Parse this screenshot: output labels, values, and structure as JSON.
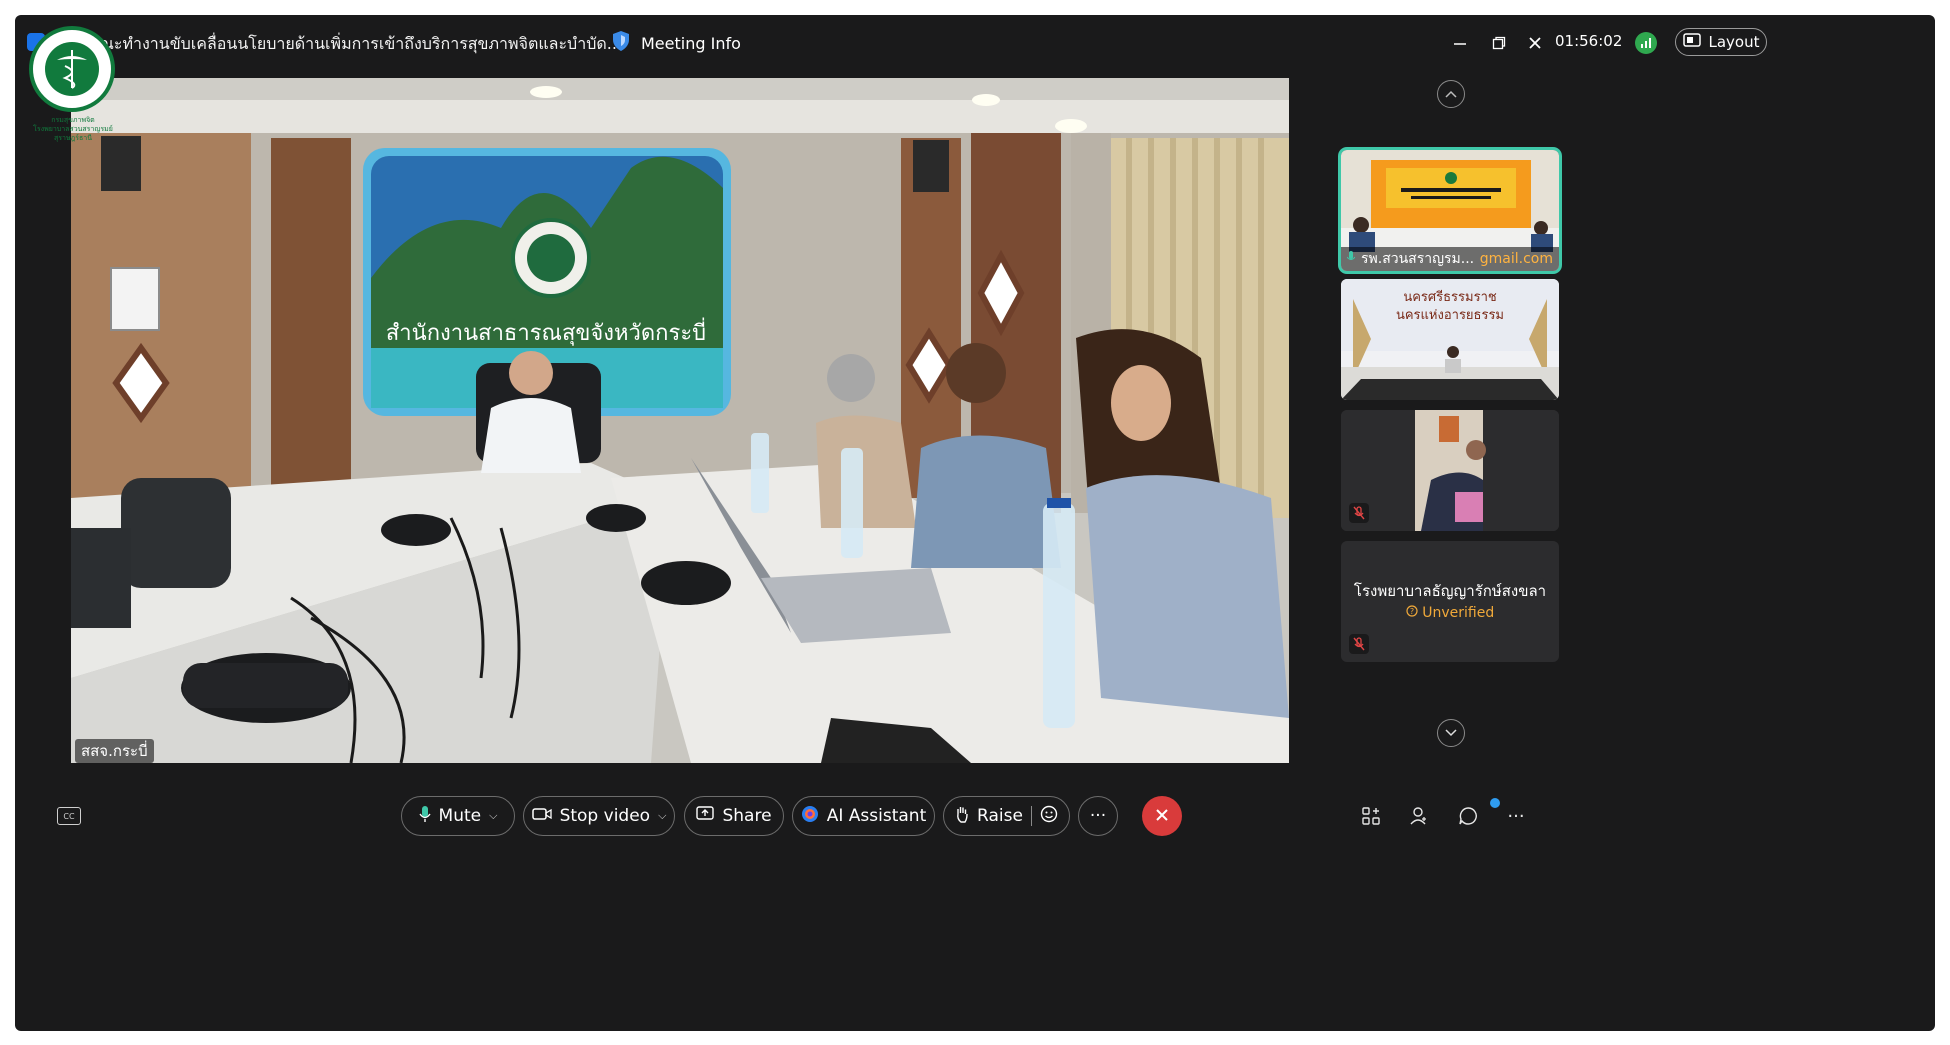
{
  "titlebar": {
    "meeting_title": "ณะทำงานขับเคลื่อนนโยบายด้านเพิ่มการเข้าถึงบริการสุขภาพจิตและบำบัด...",
    "meeting_info_label": "Meeting Info",
    "timer": "01:56:02",
    "layout_label": "Layout",
    "icons": [
      "shield-icon",
      "network-signal-icon",
      "layout-icon",
      "minimize-icon",
      "restore-icon",
      "close-icon"
    ]
  },
  "logo": {
    "ring_text": "กระทรวงสาธารณสุข MINISTRY OF PUBLIC HEALTH",
    "caption_lines": [
      "กรมสุขภาพจิต",
      "โรงพยาบาลสวนสราญรมย์",
      "สุราษฎร์ธานี"
    ]
  },
  "main_video": {
    "speaker_label": "สสจ.กระบี่",
    "backdrop_text": "สำนักงานสาธารณสุขจังหวัดกระบี่"
  },
  "sidebar": {
    "tiles": [
      {
        "caption": "รพ.สวนสราญรม...",
        "email": "gmail.com",
        "active": true
      },
      {
        "banner_lines": [
          "นครศรีธรรมราช",
          "นครแห่งอารยธรรม"
        ],
        "active": false
      },
      {
        "muted": true,
        "active": false
      },
      {
        "name": "โรงพยาบาลธัญญารักษ์สงขลา",
        "status": "Unverified",
        "muted": true,
        "active": false
      }
    ]
  },
  "toolbar": {
    "mute_label": "Mute",
    "stop_video_label": "Stop video",
    "share_label": "Share",
    "ai_assistant_label": "AI Assistant",
    "raise_label": "Raise",
    "more_label": "···",
    "cc_label": "CC",
    "right_icons": [
      "apps-icon",
      "participants-icon",
      "chat-icon",
      "more-icon"
    ],
    "right_more_label": "···"
  },
  "colors": {
    "window_bg": "#1a1a1b",
    "active_tile_border": "#3fc8a9",
    "end_button": "#d93b3b",
    "unverified": "#f0a93a",
    "gmail": "#ffb340"
  }
}
